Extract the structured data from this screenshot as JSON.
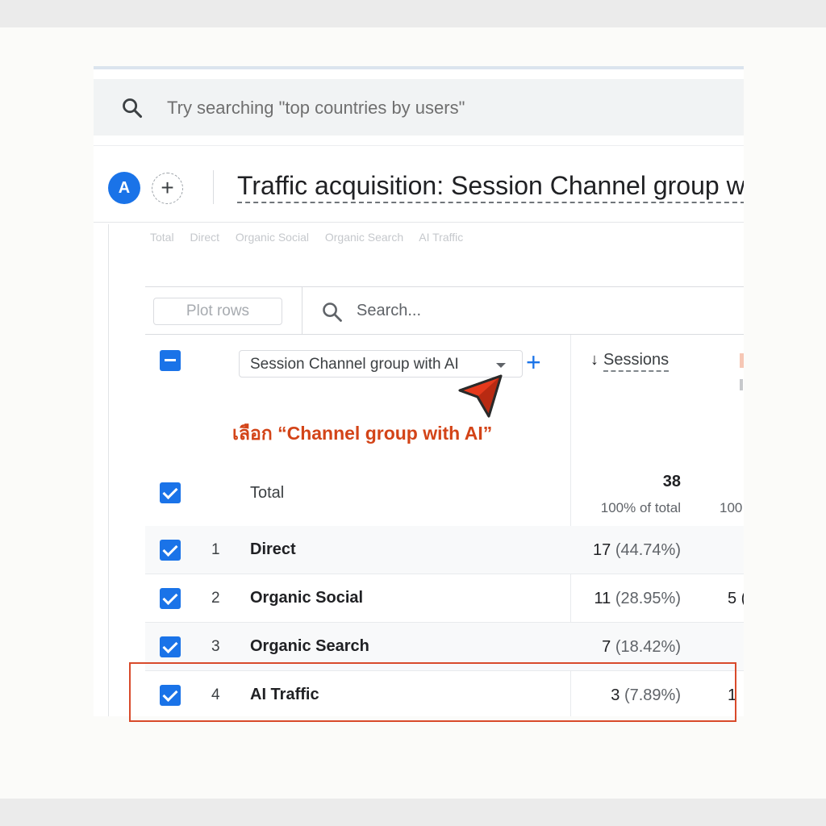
{
  "search": {
    "placeholder": "Try searching \"top countries by users\""
  },
  "header": {
    "avatar_letter": "A",
    "add_comparison": "+",
    "title": "Traffic acquisition: Session Channel group w"
  },
  "legend_ghost": [
    "Total",
    "Direct",
    "Organic Social",
    "Organic Search",
    "AI Traffic"
  ],
  "toolbar": {
    "plot_rows_label": "Plot rows",
    "search_placeholder": "Search..."
  },
  "table": {
    "dimension_selector": "Session Channel group with AI",
    "add_dimension": "+",
    "metric_header": "Sessions",
    "sort_arrow": "↓",
    "total": {
      "label": "Total",
      "value": "38",
      "sub": "100% of total",
      "peek": "100"
    },
    "rows": [
      {
        "rank": "1",
        "name": "Direct",
        "value": "17",
        "pct": "(44.74%)",
        "peek": ""
      },
      {
        "rank": "2",
        "name": "Organic Social",
        "value": "11",
        "pct": "(28.95%)",
        "peek": "5 ("
      },
      {
        "rank": "3",
        "name": "Organic Search",
        "value": "7",
        "pct": "(18.42%)",
        "peek": ""
      },
      {
        "rank": "4",
        "name": "AI Traffic",
        "value": "3",
        "pct": "(7.89%)",
        "peek": "1"
      }
    ]
  },
  "annotation": {
    "text": "เลือก  “Channel group with AI”",
    "color": "#d34418"
  },
  "colors": {
    "accent": "#1a73e8",
    "highlight_box": "#d84a2b"
  }
}
